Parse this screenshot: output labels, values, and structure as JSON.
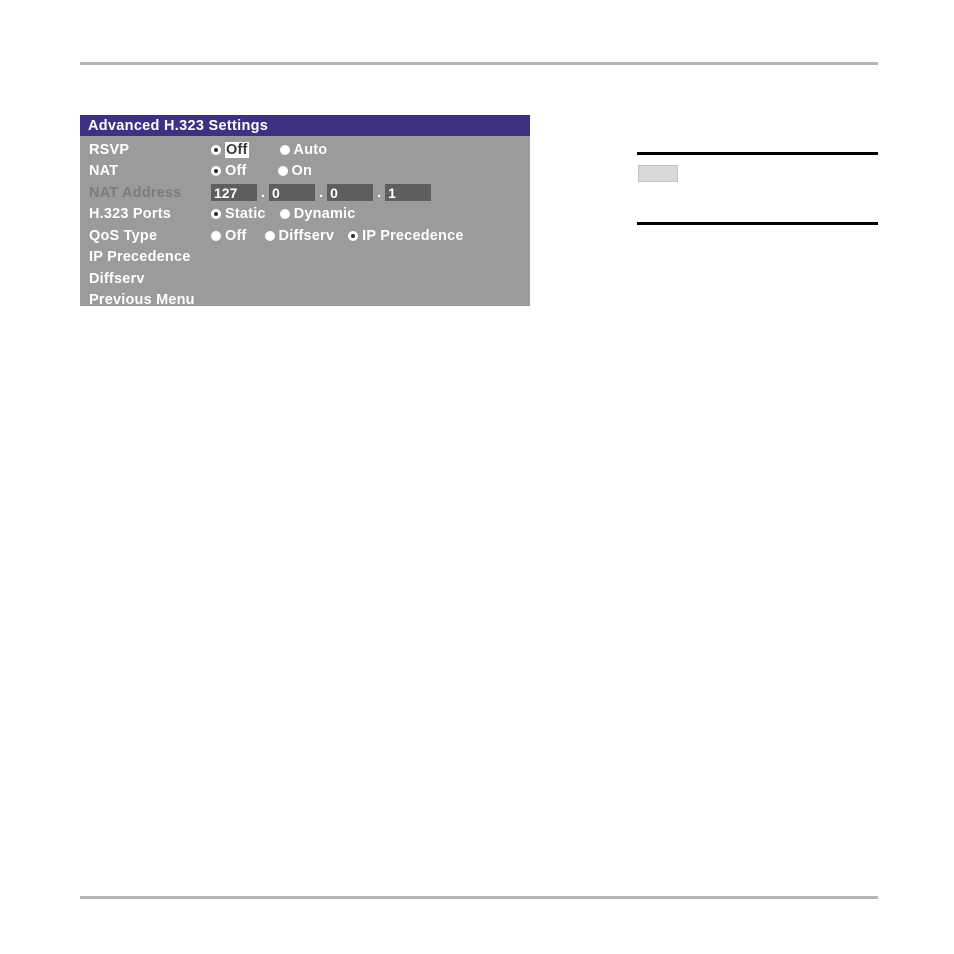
{
  "page": {
    "header_rule": "horizontal-rule",
    "footer_rule": "horizontal-rule"
  },
  "note_block": {
    "upper_rule": "horizontal-rule",
    "lower_rule": "horizontal-rule",
    "swatch_label": ""
  },
  "dialog": {
    "title": "Advanced H.323 Settings",
    "colors": {
      "titlebar": "#3d3183",
      "panel": "#9b9b9b",
      "text": "#ffffff",
      "disabled_text": "#7b7b7b",
      "field": "#5e5e5e",
      "focus_background": "#ffffff"
    },
    "rows": {
      "rsvp": {
        "label": "RSVP",
        "options": [
          {
            "text": "Off",
            "selected": true,
            "focused": true
          },
          {
            "text": "Auto",
            "selected": false,
            "focused": false
          }
        ]
      },
      "nat": {
        "label": "NAT",
        "options": [
          {
            "text": "Off",
            "selected": true,
            "focused": false
          },
          {
            "text": "On",
            "selected": false,
            "focused": false
          }
        ]
      },
      "nat_address": {
        "label": "NAT Address",
        "disabled": true,
        "octets": [
          "127",
          "0",
          "0",
          "1"
        ],
        "separator": "."
      },
      "h323_ports": {
        "label": "H.323 Ports",
        "options": [
          {
            "text": "Static",
            "selected": true,
            "focused": false
          },
          {
            "text": "Dynamic",
            "selected": false,
            "focused": false
          }
        ]
      },
      "qos_type": {
        "label": "QoS Type",
        "options": [
          {
            "text": "Off",
            "selected": false,
            "focused": false
          },
          {
            "text": "Diffserv",
            "selected": false,
            "focused": false
          },
          {
            "text": "IP Precedence",
            "selected": true,
            "focused": false
          }
        ]
      }
    },
    "menu_entries": [
      {
        "label": "IP Precedence"
      },
      {
        "label": "Diffserv"
      },
      {
        "label": "Previous Menu"
      }
    ]
  }
}
